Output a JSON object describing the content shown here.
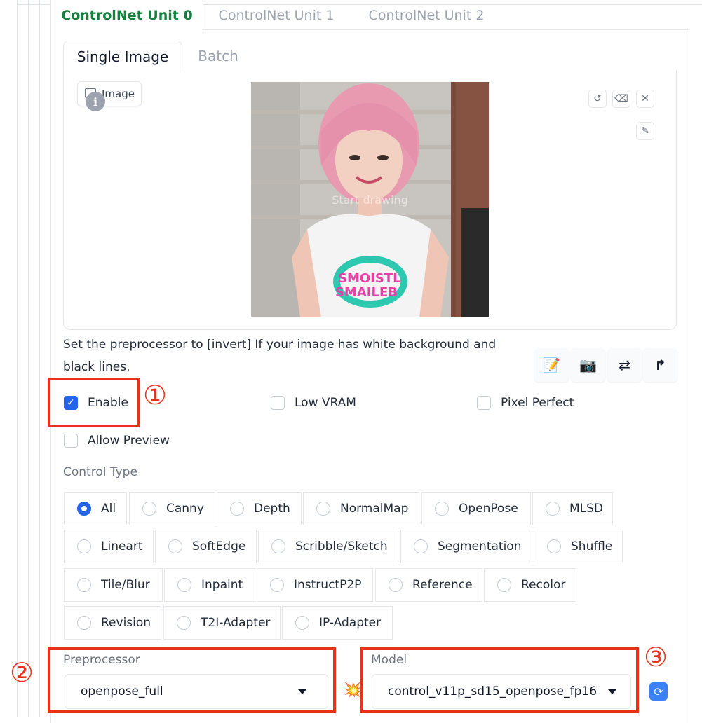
{
  "unit_tabs": [
    "ControlNet Unit 0",
    "ControlNet Unit 1",
    "ControlNet Unit 2"
  ],
  "image_tabs": [
    "Single Image",
    "Batch"
  ],
  "image_panel": {
    "label": "Image",
    "info_glyph": "i",
    "canvas_placeholder": "Start drawing",
    "tools": [
      "undo-icon",
      "eraser-icon",
      "close-icon",
      "brush-icon"
    ]
  },
  "hint": "Set the preprocessor to [invert] If your image has white background and black lines.",
  "action_buttons": [
    {
      "icon": "memo-icon",
      "glyph": "📝"
    },
    {
      "icon": "camera-icon",
      "glyph": "📷"
    },
    {
      "icon": "swap-icon",
      "glyph": "⇄"
    },
    {
      "icon": "send-up-icon",
      "glyph": "↱"
    }
  ],
  "checkboxes": {
    "enable": {
      "label": "Enable",
      "checked": true
    },
    "low_vram": {
      "label": "Low VRAM",
      "checked": false
    },
    "pixel_perfect": {
      "label": "Pixel Perfect",
      "checked": false
    },
    "allow_preview": {
      "label": "Allow Preview",
      "checked": false
    }
  },
  "control_type": {
    "label": "Control Type",
    "selected": "All",
    "options": [
      "All",
      "Canny",
      "Depth",
      "NormalMap",
      "OpenPose",
      "MLSD",
      "Lineart",
      "SoftEdge",
      "Scribble/Sketch",
      "Segmentation",
      "Shuffle",
      "Tile/Blur",
      "Inpaint",
      "InstructP2P",
      "Reference",
      "Recolor",
      "Revision",
      "T2I-Adapter",
      "IP-Adapter"
    ]
  },
  "preprocessor": {
    "label": "Preprocessor",
    "value": "openpose_full"
  },
  "model": {
    "label": "Model",
    "value": "control_v11p_sd15_openpose_fp16"
  },
  "run_icon": {
    "icon": "explosion-icon",
    "glyph": "💥"
  },
  "refresh_icon": {
    "icon": "refresh-icon",
    "glyph": "🔄"
  },
  "annotations": {
    "one": "①",
    "two": "②",
    "three": "③",
    "color": "#e8301a"
  },
  "colors": {
    "accent": "#2563eb",
    "active_tab": "#15803d",
    "annotation": "#e8301a"
  }
}
